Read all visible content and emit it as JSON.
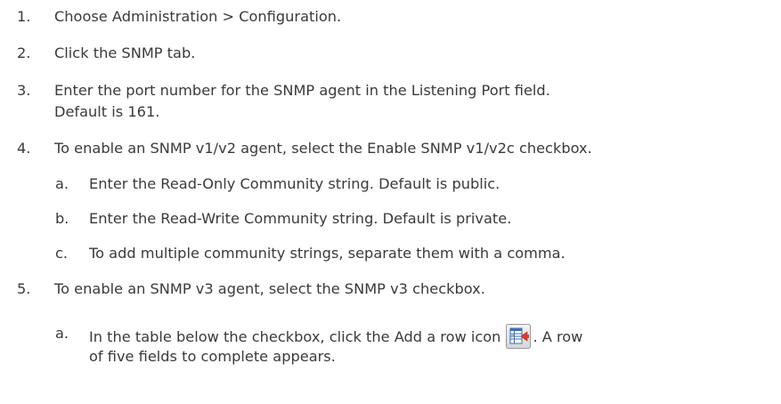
{
  "steps": [
    {
      "num": "1.",
      "text": "Choose Administration > Configuration."
    },
    {
      "num": "2.",
      "text": "Click the SNMP tab."
    },
    {
      "num": "3.",
      "text": "Enter the port number for the SNMP agent in the Listening Port field.",
      "text2": "Default is 161."
    },
    {
      "num": "4.",
      "text": "To enable an SNMP v1/v2 agent, select the Enable SNMP v1/v2c checkbox.",
      "sub": [
        {
          "num": "a.",
          "text": "Enter the Read-Only Community string. Default is public."
        },
        {
          "num": "b.",
          "text": "Enter the Read-Write Community string. Default is private."
        },
        {
          "num": "c.",
          "text": "To add multiple community strings, separate them with a comma."
        }
      ]
    },
    {
      "num": "5.",
      "text": "To enable an SNMP v3 agent, select the SNMP v3 checkbox.",
      "sub": [
        {
          "num": "a.",
          "text": "In the table below the checkbox, click the Add a row icon",
          "text_after": ". A row",
          "text2": "of five fields to complete appears.",
          "icon": "add-row-icon"
        }
      ]
    }
  ]
}
